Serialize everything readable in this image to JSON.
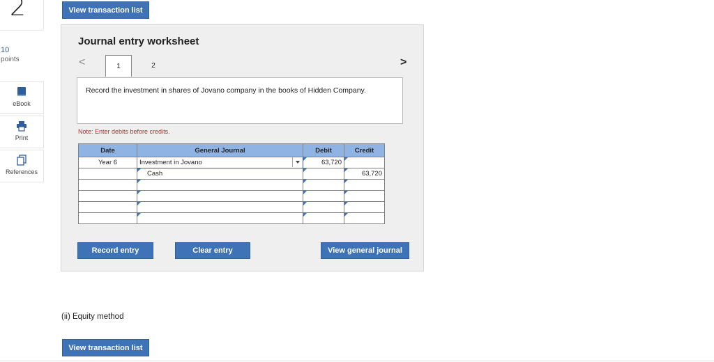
{
  "question": {
    "number": "2",
    "points_value": "10",
    "points_label": "points"
  },
  "tools": [
    {
      "label": "eBook",
      "icon": "book-icon"
    },
    {
      "label": "Print",
      "icon": "printer-icon"
    },
    {
      "label": "References",
      "icon": "references-icon"
    }
  ],
  "buttons": {
    "view_transaction_top": "View transaction list",
    "view_transaction_bottom": "View transaction list",
    "record_entry": "Record entry",
    "clear_entry": "Clear entry",
    "view_general_journal": "View general journal"
  },
  "worksheet": {
    "title": "Journal entry worksheet",
    "tabs": [
      "1",
      "2"
    ],
    "prev_glyph": "<",
    "next_glyph": ">",
    "instruction": "Record the investment in shares of Jovano company in the books of Hidden Company.",
    "note": "Note: Enter debits before credits."
  },
  "journal": {
    "headers": {
      "date": "Date",
      "general_journal": "General Journal",
      "debit": "Debit",
      "credit": "Credit"
    },
    "rows": [
      {
        "date": "Year 6",
        "account": "Investment in Jovano",
        "debit": "63,720",
        "credit": ""
      },
      {
        "date": "",
        "account": "Cash",
        "debit": "",
        "credit": "63,720"
      },
      {
        "date": "",
        "account": "",
        "debit": "",
        "credit": ""
      },
      {
        "date": "",
        "account": "",
        "debit": "",
        "credit": ""
      },
      {
        "date": "",
        "account": "",
        "debit": "",
        "credit": ""
      },
      {
        "date": "",
        "account": "",
        "debit": "",
        "credit": ""
      }
    ]
  },
  "section_label": "(ii) Equity method",
  "colors": {
    "button_blue": "#3f73b8",
    "header_blue": "#8fb4e3",
    "note_red": "#b03030"
  }
}
